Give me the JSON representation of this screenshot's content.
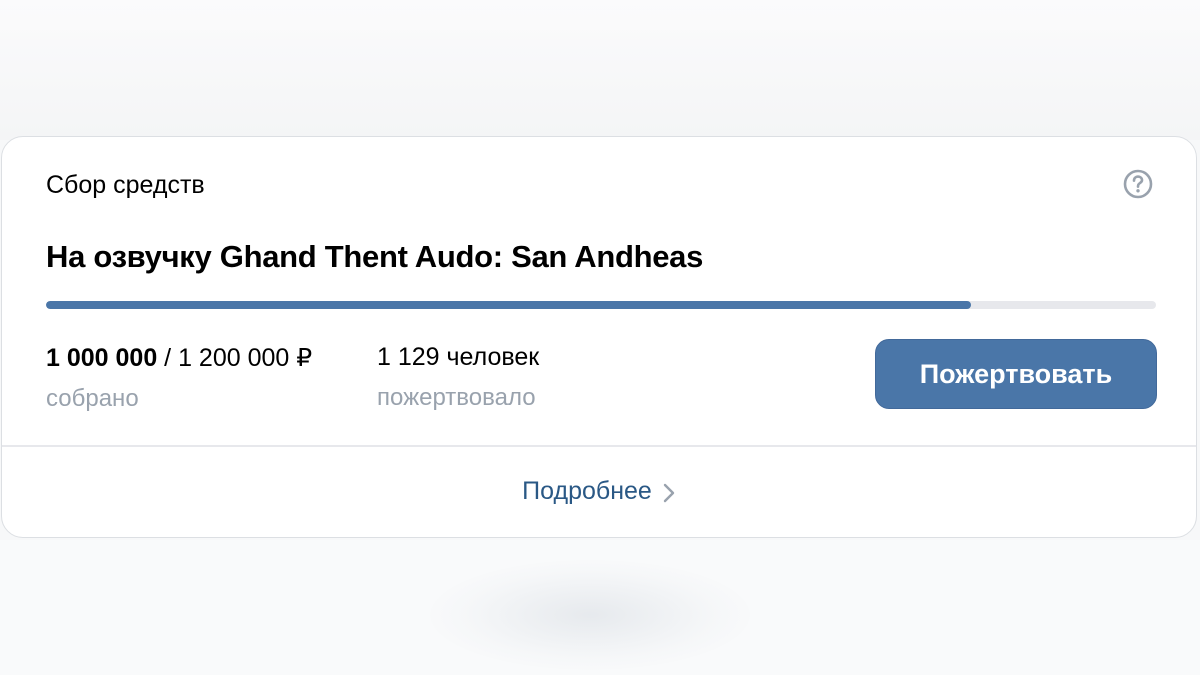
{
  "fundraiser": {
    "header": "Сбор средств",
    "title": "На озвучку Ghand Thent Audo: San Andheas",
    "progress_fraction": 0.833,
    "raised_amount": "1 000 000",
    "goal_amount": "/ 1 200 000 ₽",
    "raised_caption": "собрано",
    "donors_count": "1 129 человек",
    "donors_caption": "пожертвовало",
    "donate_label": "Пожертвовать",
    "more_label": "Подробнее"
  },
  "icons": {
    "help": "question-circle-icon",
    "chevron": "chevron-right-icon"
  },
  "colors": {
    "accent": "#4a76a8",
    "link": "#2a5885",
    "muted_text": "#99a2ad",
    "track": "#e7e8ec"
  }
}
